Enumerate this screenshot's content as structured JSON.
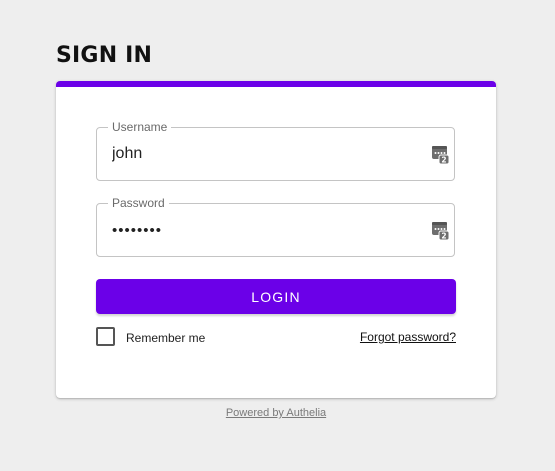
{
  "header": {
    "title": "SIGN IN"
  },
  "form": {
    "username": {
      "label": "Username",
      "value": "john"
    },
    "password": {
      "label": "Password",
      "value": "••••••••"
    },
    "login_label": "LOGIN",
    "remember_label": "Remember me",
    "remember_checked": false,
    "forgot_label": "Forgot password?"
  },
  "footer": {
    "powered_label": "Powered by Authelia"
  },
  "icons": {
    "field_icon": "password-manager-key-icon"
  },
  "colors": {
    "accent": "#6b00e8",
    "background": "#eeeeee",
    "card": "#ffffff"
  }
}
